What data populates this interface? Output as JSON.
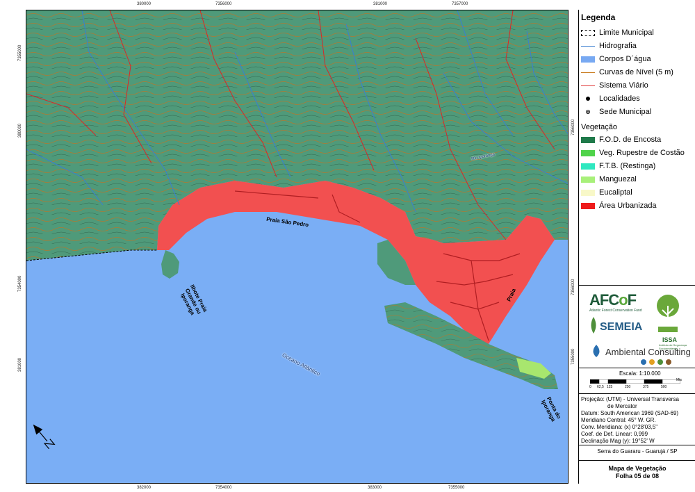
{
  "coords": {
    "top_easting": [
      "380000",
      "381000"
    ],
    "top_northing": [
      "7356000",
      "7357000"
    ],
    "bottom_easting": [
      "382000",
      "383000"
    ],
    "bottom_northing": [
      "7354000",
      "7355000"
    ],
    "left_northing": [
      "7355000",
      "380000",
      "7354000",
      "381000"
    ],
    "right_northing": [
      "7356000",
      "7356000",
      "7355000"
    ]
  },
  "map_labels": {
    "beach": "Praia São Pedro",
    "islet": "Ilhote Praia Grande ou Iporanga",
    "ocean": "Oceano Atlântico",
    "praia": "Praia",
    "point": "Ponta do Iporanga",
    "river": "Rio Iporanga"
  },
  "legend": {
    "title": "Legenda",
    "items": [
      {
        "label": "Limite Municipal",
        "kind": "dashed-box",
        "color": "#000000"
      },
      {
        "label": "Hidrografia",
        "kind": "line",
        "color": "#3a7fd0"
      },
      {
        "label": "Corpos D´água",
        "kind": "box",
        "color": "#78a9f2"
      },
      {
        "label": "Curvas de Nível (5 m)",
        "kind": "line",
        "color": "#c87a1c"
      },
      {
        "label": "Sistema Viário",
        "kind": "line",
        "color": "#e03a3a"
      },
      {
        "label": "Localidades",
        "kind": "dot",
        "color": "#000000"
      },
      {
        "label": "Sede Municipal",
        "kind": "dot2",
        "color": "#000000"
      }
    ],
    "vegetation_heading": "Vegetação",
    "vegetation": [
      {
        "label": "F.O.D. de Encosta",
        "color": "#1f7a4a"
      },
      {
        "label": "Veg. Rupestre de Costão",
        "color": "#4fd34a"
      },
      {
        "label": "F.T.B. (Restinga)",
        "color": "#2fe8c0"
      },
      {
        "label": "Manguezal",
        "color": "#a8f07a"
      },
      {
        "label": "Eucaliptal",
        "color": "#f8f8c8"
      },
      {
        "label": "Área Urbanizada",
        "color": "#ee1c1c"
      }
    ]
  },
  "logos": {
    "afcof": "AFCoF",
    "afcof_sub": "Atlantic Forest Conservation Fund",
    "semeia": "SEMEIA",
    "ambiental": "Ambiental Consulting",
    "issa": "ISSA",
    "issa_sub": "Instituto de Segurança Socioambiental"
  },
  "scale": {
    "label": "Escala: 1:10.000",
    "ticks": [
      "0",
      "62,5",
      "125",
      "250",
      "375",
      "500"
    ],
    "unit": "Mts"
  },
  "projection": [
    "Projeção: (UTM) - Universal Transversa",
    "de Mercator",
    "Datum: South American 1969 (SAD-69)",
    "Meridiano Central: 45° W. GR.",
    "Conv. Meridiana: (x) 0°28'03,5\"",
    "Coef. de Def. Linear: 0,999",
    "Declinação Mag (y): 19°52' W"
  ],
  "place": "Serra do Guararu - Guarujá / SP",
  "map_title": [
    "Mapa de Vegetação",
    "Folha 05 de 08"
  ],
  "colors": {
    "ocean": "#7aaef5",
    "forest": "#4f9a7a",
    "urban": "#f25050",
    "contour": "#b8762a",
    "river": "#3a7fd0",
    "road": "#d8262a"
  }
}
